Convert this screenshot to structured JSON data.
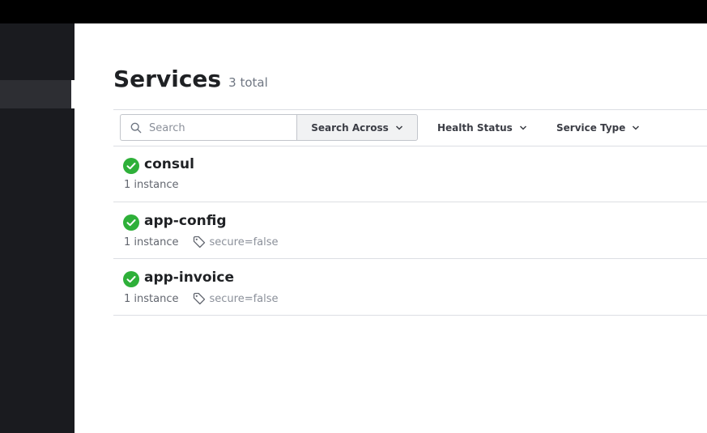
{
  "page": {
    "title": "Services",
    "count_label": "3 total"
  },
  "toolbar": {
    "search_placeholder": "Search",
    "search_across_label": "Search Across",
    "health_status_label": "Health Status",
    "service_type_label": "Service Type"
  },
  "services": [
    {
      "name": "consul",
      "instances": "1 instance",
      "tag": ""
    },
    {
      "name": "app-config",
      "instances": "1 instance",
      "tag": "secure=false"
    },
    {
      "name": "app-invoice",
      "instances": "1 instance",
      "tag": "secure=false"
    }
  ],
  "colors": {
    "healthy": "#2eb039",
    "sidebar": "#1a1b1f",
    "topbar": "#000000"
  },
  "icons": {
    "search": "search-icon",
    "chevron": "chevron-down-icon",
    "health": "check-circle-icon",
    "tag": "tag-icon"
  }
}
